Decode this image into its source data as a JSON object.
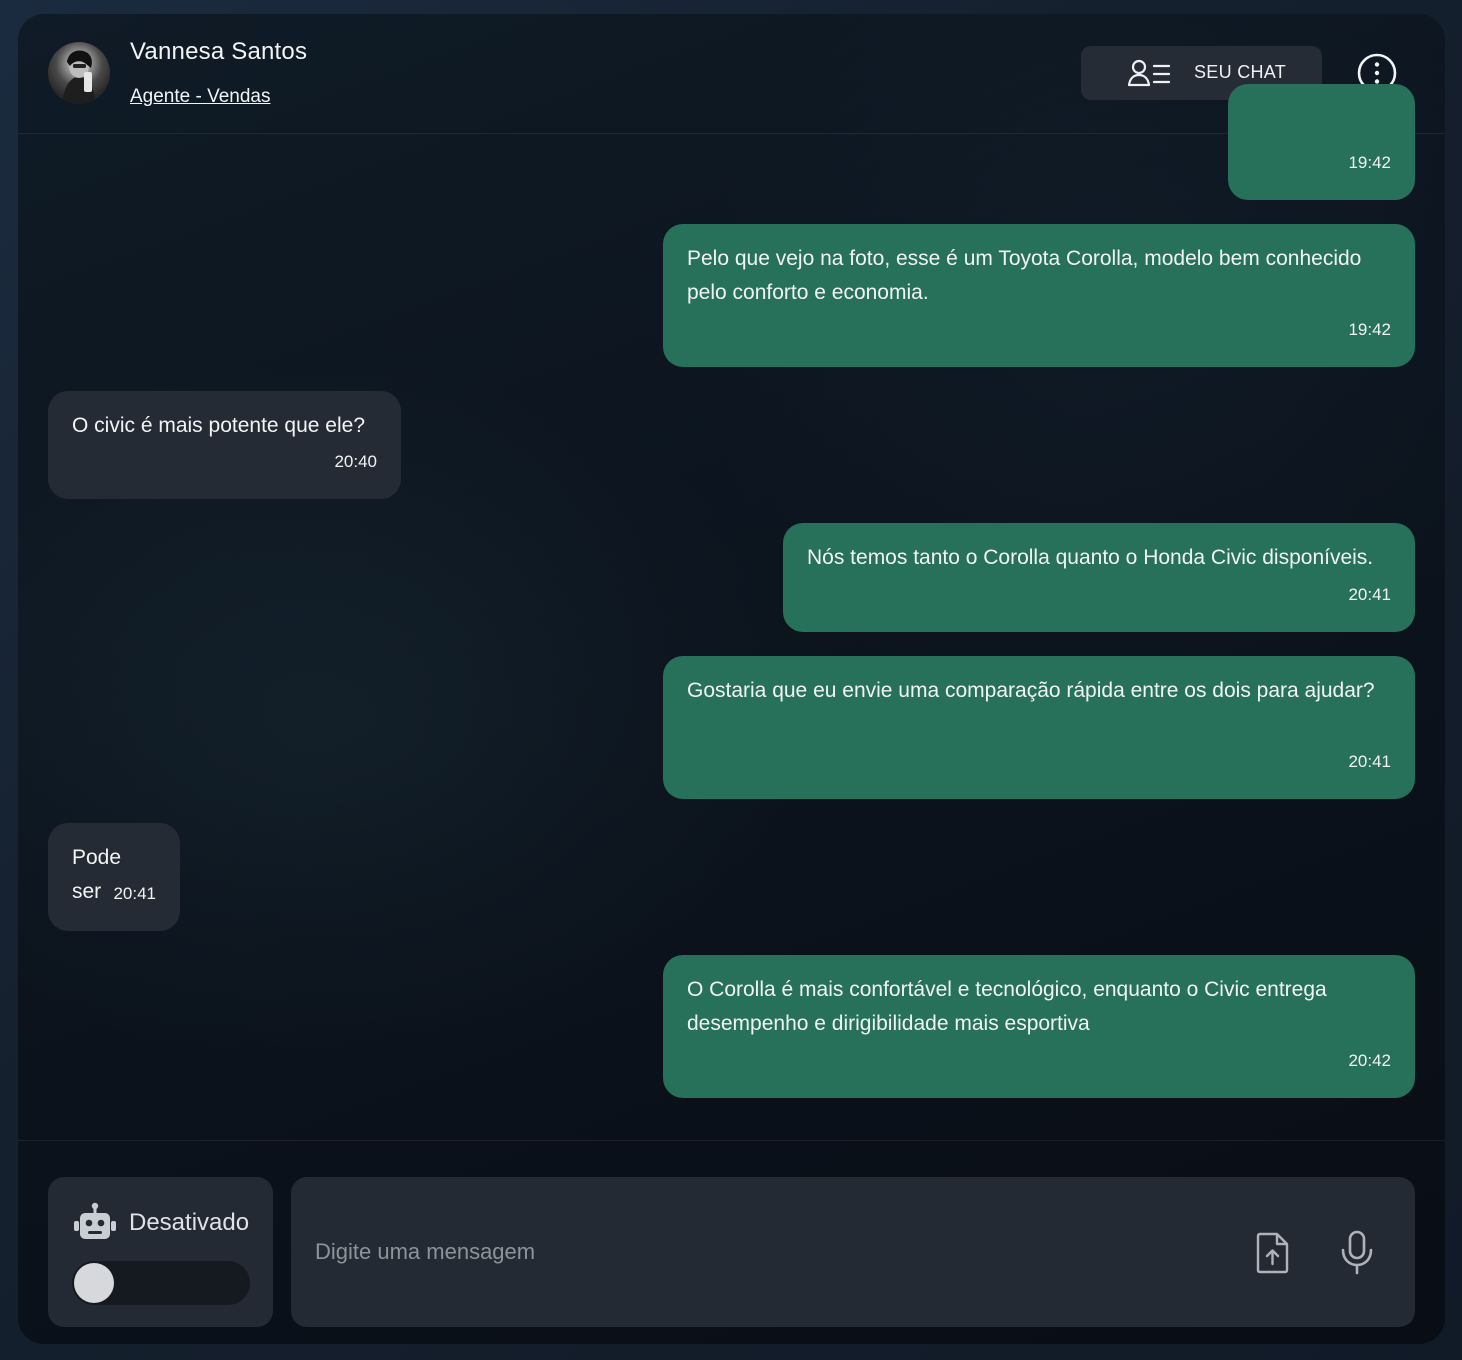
{
  "header": {
    "agent_name": "Vannesa Santos",
    "agent_role": "Agente - Vendas",
    "seu_chat_label": "SEU CHAT"
  },
  "messages": [
    {
      "direction": "outgoing",
      "text": "",
      "time": "19:42"
    },
    {
      "direction": "outgoing",
      "text": "Pelo que vejo na foto, esse é um Toyota Corolla, modelo bem conhecido pelo conforto e economia.",
      "time": "19:42"
    },
    {
      "direction": "incoming",
      "text": "O civic é mais potente que ele?",
      "time": "20:40"
    },
    {
      "direction": "outgoing",
      "text": "Nós temos tanto o Corolla quanto o Honda Civic disponíveis.",
      "time": "20:41"
    },
    {
      "direction": "outgoing",
      "text": "Gostaria que eu envie uma comparação rápida entre os dois para ajudar?",
      "time": "20:41"
    },
    {
      "direction": "incoming",
      "text": "Pode ser",
      "time": "20:41"
    },
    {
      "direction": "outgoing",
      "text": "O Corolla é mais confortável e tecnológico, enquanto o Civic entrega desempenho e dirigibilidade mais esportiva",
      "time": "20:42"
    }
  ],
  "footer": {
    "bot_status": "Desativado",
    "bot_enabled": false,
    "input_placeholder": "Digite uma mensagem",
    "input_value": ""
  },
  "colors": {
    "outgoing_bubble": "#27705a",
    "incoming_bubble": "#252b35",
    "panel_bg": "#0c141e"
  },
  "icons": {
    "seu_chat": "user-list-icon",
    "more": "more-vertical-icon",
    "bot": "robot-icon",
    "upload": "file-upload-icon",
    "mic": "microphone-icon"
  }
}
